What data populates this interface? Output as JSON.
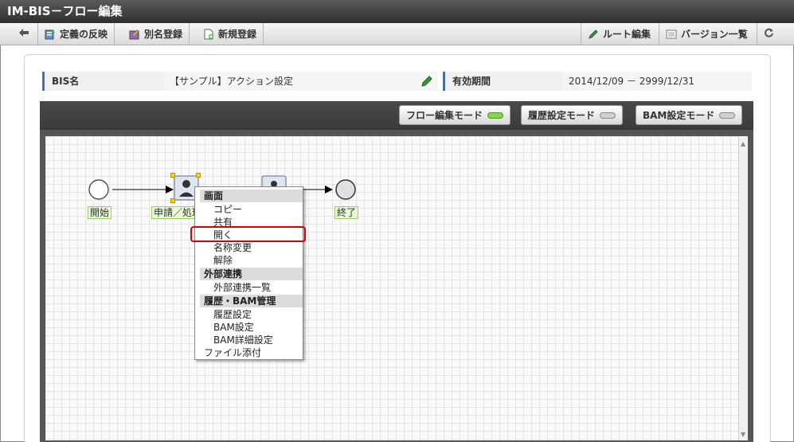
{
  "window": {
    "title": "IM-BIS－フロー編集"
  },
  "toolbar": {
    "back_label": "",
    "apply_label": "定義の反映",
    "alias_label": "別名登録",
    "new_label": "新規登録",
    "route_edit_label": "ルート編集",
    "version_list_label": "バージョン一覧"
  },
  "info": {
    "bis_name_label": "BIS名",
    "bis_name_value": "【サンプル】アクション設定",
    "period_label": "有効期間",
    "period_value": "2014/12/09 － 2999/12/31"
  },
  "modes": [
    {
      "label": "フロー編集モード",
      "active": true
    },
    {
      "label": "履歴設定モード",
      "active": false
    },
    {
      "label": "BAM設定モード",
      "active": false
    }
  ],
  "nodes": {
    "start": "開始",
    "task": "申請／処理",
    "end": "終了"
  },
  "context_menu": {
    "screen_header": "画面",
    "copy": "コピー",
    "share": "共有",
    "open": "開く",
    "rename": "名称変更",
    "release": "解除",
    "external_header": "外部連携",
    "external_list": "外部連携一覧",
    "history_header": "履歴・BAM管理",
    "history_setting": "履歴設定",
    "bam_setting": "BAM設定",
    "bam_detail": "BAM詳細設定",
    "attach": "ファイル添付"
  },
  "colors": {
    "accent": "#4a6fa5",
    "active_led": "#7cd84a",
    "highlight": "#dd0000"
  }
}
